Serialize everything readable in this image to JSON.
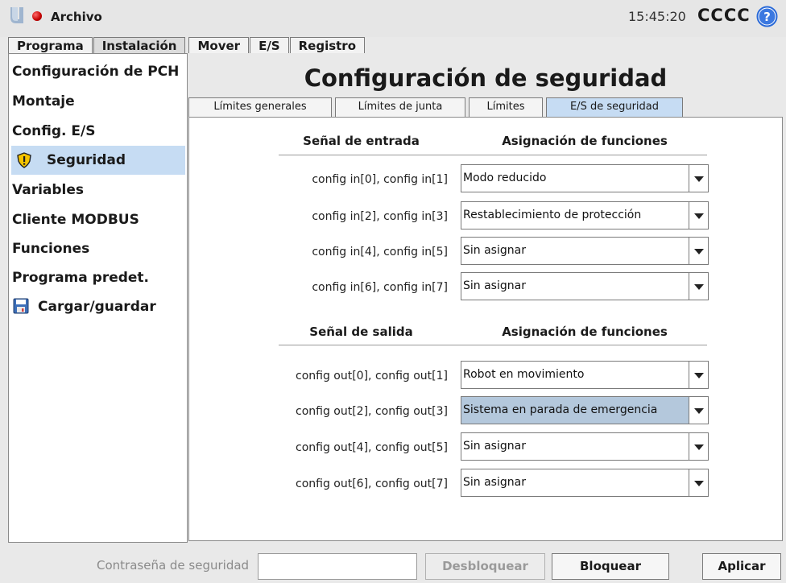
{
  "header": {
    "file_menu": "Archivo",
    "time": "15:45:20",
    "robot_name": "CCCC",
    "colors": {
      "power": "#d00000",
      "help": "#2a6ad8"
    }
  },
  "main_tabs": [
    "Programa",
    "Instalación",
    "Mover",
    "E/S",
    "Registro"
  ],
  "sidebar": {
    "items": [
      {
        "label": "Configuración de PCH"
      },
      {
        "label": "Montaje"
      },
      {
        "label": "Config. E/S"
      },
      {
        "label": "Seguridad",
        "icon": "warning-shield-icon",
        "selected": true
      },
      {
        "label": "Variables"
      },
      {
        "label": "Cliente MODBUS"
      },
      {
        "label": "Funciones"
      },
      {
        "label": "Programa predet."
      },
      {
        "label": "Cargar/guardar",
        "icon": "floppy-disk-icon"
      }
    ]
  },
  "main": {
    "title": "Configuración de seguridad",
    "sub_tabs": [
      "Límites generales",
      "Límites de junta",
      "Límites",
      "E/S de seguridad"
    ],
    "active_sub_tab": "E/S de seguridad",
    "input_section": {
      "signal_header": "Señal de entrada",
      "function_header": "Asignación de funciones",
      "rows": [
        {
          "signal": "config in[0], config in[1]",
          "function": "Modo reducido"
        },
        {
          "signal": "config in[2], config in[3]",
          "function": "Restablecimiento de protección"
        },
        {
          "signal": "config in[4], config in[5]",
          "function": "Sin asignar"
        },
        {
          "signal": "config in[6], config in[7]",
          "function": "Sin asignar"
        }
      ]
    },
    "output_section": {
      "signal_header": "Señal de salida",
      "function_header": "Asignación de funciones",
      "rows": [
        {
          "signal": "config out[0], config out[1]",
          "function": "Robot en movimiento"
        },
        {
          "signal": "config out[2], config out[3]",
          "function": "Sistema en parada de emergencia",
          "highlighted": true
        },
        {
          "signal": "config out[4], config out[5]",
          "function": "Sin asignar"
        },
        {
          "signal": "config out[6], config out[7]",
          "function": "Sin asignar"
        }
      ]
    }
  },
  "footer": {
    "password_label": "Contraseña de seguridad",
    "password_value": "",
    "unlock_label": "Desbloquear",
    "lock_label": "Bloquear",
    "apply_label": "Aplicar"
  }
}
